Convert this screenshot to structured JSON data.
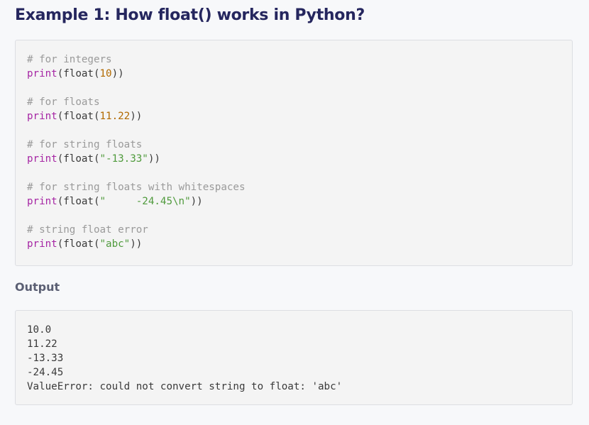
{
  "page": {
    "title": "Example 1: How float() works in Python?",
    "output_heading": "Output"
  },
  "code": [
    {
      "comment": "# for integers"
    },
    {
      "call": "print",
      "mid": "(float(",
      "arg_num": "10",
      "end": "))"
    },
    {
      "comment": "# for floats"
    },
    {
      "call": "print",
      "mid": "(float(",
      "arg_num": "11.22",
      "end": "))"
    },
    {
      "comment": "# for string floats"
    },
    {
      "call": "print",
      "mid": "(float(",
      "arg_str": "\"-13.33\"",
      "end": "))"
    },
    {
      "comment": "# for string floats with whitespaces"
    },
    {
      "call": "print",
      "mid": "(float(",
      "arg_str": "\"     -24.45\\n\"",
      "end": "))"
    },
    {
      "comment": "# string float error"
    },
    {
      "call": "print",
      "mid": "(float(",
      "arg_str": "\"abc\"",
      "end": "))"
    }
  ],
  "output": [
    "10.0",
    "11.22",
    "-13.33",
    "-24.45",
    "ValueError: could not convert string to float: 'abc'"
  ]
}
